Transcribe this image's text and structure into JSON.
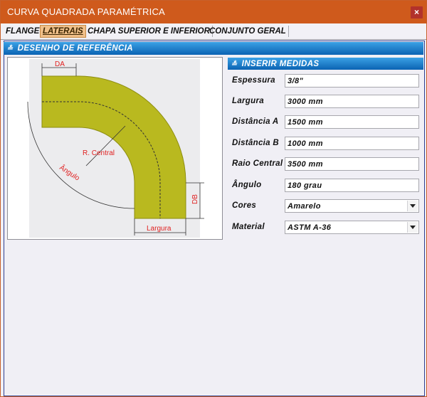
{
  "window": {
    "title": "CURVA QUADRADA PARAMÉTRICA",
    "close_glyph": "×"
  },
  "tabs": [
    {
      "label": "FLANGE"
    },
    {
      "label": "LATERAIS",
      "active": true
    },
    {
      "label": "CHAPA SUPERIOR E INFERIOR"
    },
    {
      "label": "CONJUNTO GERAL"
    }
  ],
  "sections": {
    "reference": "DESENHO DE REFERÊNCIA",
    "measures": "INSERIR MEDIDAS"
  },
  "drawing": {
    "label_da": "DA",
    "label_db": "DB",
    "label_radius": "R. Central",
    "label_angle": "Ângulo",
    "label_width": "Largura",
    "fill_color": "#b9b91f"
  },
  "form": [
    {
      "label": "Espessura",
      "value": "3/8\"",
      "type": "text"
    },
    {
      "label": "Largura",
      "value": "3000 mm",
      "type": "text"
    },
    {
      "label": "Distância A",
      "value": "1500 mm",
      "type": "text"
    },
    {
      "label": "Distância B",
      "value": "1000 mm",
      "type": "text"
    },
    {
      "label": "Raio Central",
      "value": "3500 mm",
      "type": "text"
    },
    {
      "label": "Ângulo",
      "value": "180 grau",
      "type": "text"
    },
    {
      "label": "Cores",
      "value": "Amarelo",
      "type": "select"
    },
    {
      "label": "Material",
      "value": "ASTM A-36",
      "type": "select"
    }
  ]
}
